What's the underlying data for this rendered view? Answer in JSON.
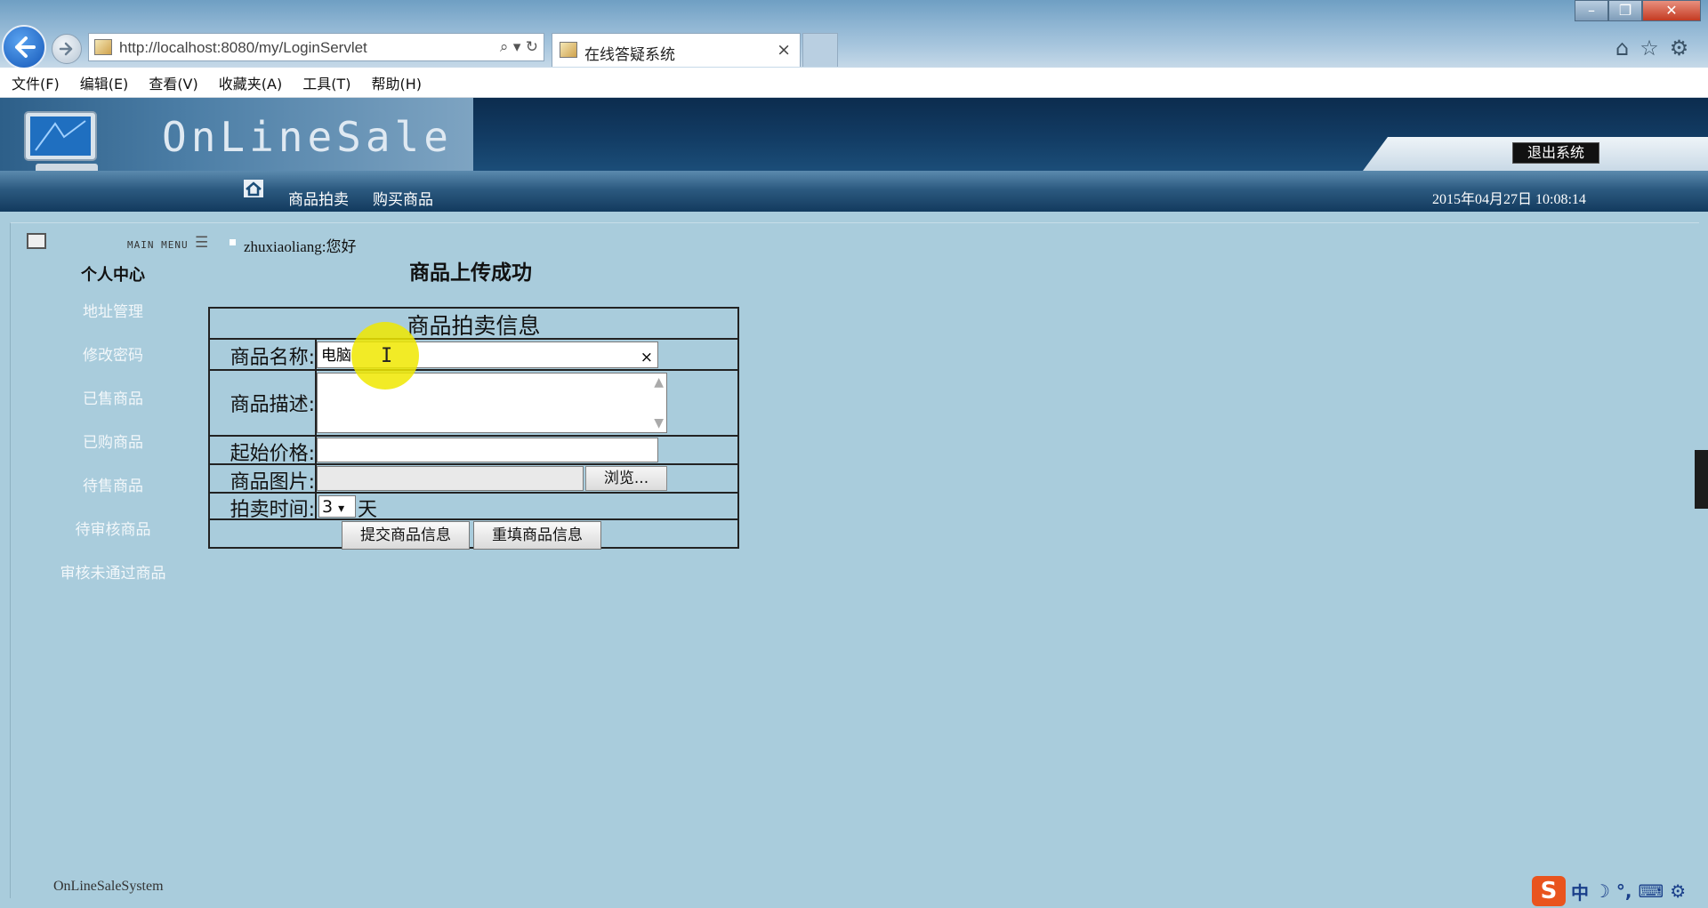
{
  "browser": {
    "url": "http://localhost:8080/my/LoginServlet",
    "tab_title": "在线答疑系统",
    "tab_close": "×",
    "url_tools": "⌕ ▾ ↻",
    "window_controls": {
      "minimize": "–",
      "maximize": "❐",
      "close": "✕"
    },
    "icons": [
      "home-icon",
      "favorites-star-icon",
      "settings-gear-icon"
    ]
  },
  "menu_bar": {
    "items": [
      "文件(F)",
      "编辑(E)",
      "查看(V)",
      "收藏夹(A)",
      "工具(T)",
      "帮助(H)"
    ]
  },
  "site": {
    "logo_text": "OnLineSale",
    "logout_label": "退出系统",
    "nav": {
      "auction": "商品拍卖",
      "buy": "购买商品"
    },
    "datetime": "2015年04月27日 10:08:14"
  },
  "sidebar": {
    "main_menu_label": "MAIN MENU",
    "title": "个人中心",
    "items": [
      "地址管理",
      "修改密码",
      "已售商品",
      "已购商品",
      "待售商品",
      "待审核商品",
      "审核未通过商品"
    ]
  },
  "main": {
    "greeting": "zhuxiaoliang:您好",
    "page_title": "商品上传成功"
  },
  "form": {
    "title": "商品拍卖信息",
    "labels": {
      "name": "商品名称:",
      "description": "商品描述:",
      "start_price": "起始价格:",
      "image": "商品图片:",
      "duration": "拍卖时间:"
    },
    "values": {
      "name": "电脑",
      "description": "",
      "start_price": "",
      "image": "",
      "duration": "3"
    },
    "duration_unit": "天",
    "clear_glyph": "×",
    "browse_label": "浏览...",
    "submit_label": "提交商品信息",
    "reset_label": "重填商品信息"
  },
  "footer": {
    "text": "OnLineSaleSystem"
  },
  "ime": {
    "logo": "S",
    "mode": "中",
    "symbols": "☽ °, ⌨ ⚙"
  },
  "colors": {
    "page_background": "#a9ccdc",
    "banner": "#123c64",
    "cursor_highlight": "#f0e800"
  }
}
